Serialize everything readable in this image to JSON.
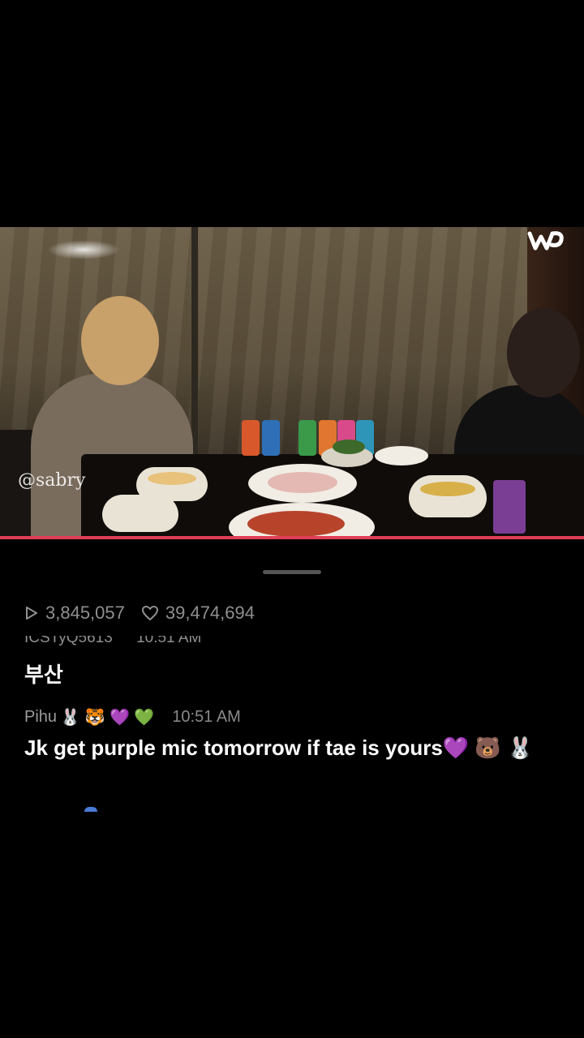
{
  "video": {
    "watermark": "@sabry",
    "logo_icon": "weverse-w-logo",
    "progress_color": "#e03e56"
  },
  "stats": {
    "plays": "3,845,057",
    "likes": "39,474,694"
  },
  "chat": {
    "cutoff_user": "ICSTyQ5613",
    "cutoff_time": "10:51 AM",
    "cutoff_message": "부산",
    "item": {
      "username": "Pihu",
      "user_emojis": "🐰 🐯 💜 💚",
      "time": "10:51 AM",
      "message": "Jk get purple mic tomorrow if tae is yours💜 🐻 🐰"
    }
  }
}
